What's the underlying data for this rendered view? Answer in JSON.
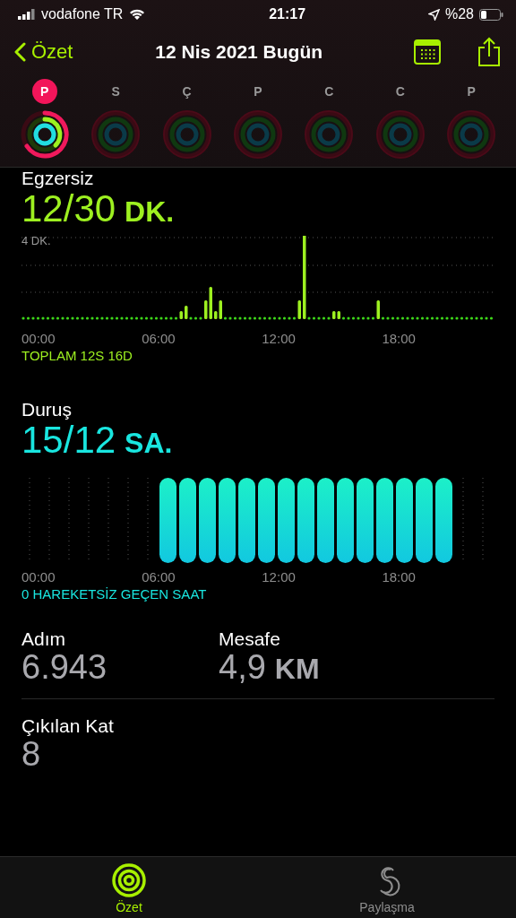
{
  "status_bar": {
    "carrier": "vodafone TR",
    "time": "21:17",
    "battery": "%28"
  },
  "nav": {
    "back": "Özet",
    "title": "12 Nis 2021 Bugün"
  },
  "days": [
    {
      "label": "P",
      "selected": true
    },
    {
      "label": "S",
      "selected": false
    },
    {
      "label": "Ç",
      "selected": false
    },
    {
      "label": "P",
      "selected": false
    },
    {
      "label": "C",
      "selected": false
    },
    {
      "label": "C",
      "selected": false
    },
    {
      "label": "P",
      "selected": false
    }
  ],
  "exercise": {
    "title": "Egzersiz",
    "value": "12/30",
    "unit": "DK.",
    "y_label": "4 DK.",
    "x_labels": [
      "00:00",
      "06:00",
      "12:00",
      "18:00"
    ],
    "summary": "TOPLAM 12S 16D"
  },
  "stand": {
    "title": "Duruş",
    "value": "15/12",
    "unit": "SA.",
    "x_labels": [
      "00:00",
      "06:00",
      "12:00",
      "18:00"
    ],
    "summary": "0 HAREKETSİZ GEÇEN SAAT"
  },
  "stats": [
    {
      "label": "Adım",
      "value": "6.943"
    },
    {
      "label": "Mesafe",
      "value": "4,9",
      "unit": "KM"
    },
    {
      "label": "Çıkılan Kat",
      "value": "8"
    }
  ],
  "tab_bar": [
    {
      "label": "Özet",
      "selected": true
    },
    {
      "label": "Paylaşma",
      "selected": false
    }
  ]
}
